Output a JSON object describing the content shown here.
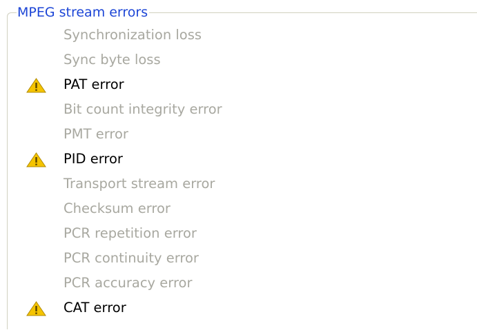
{
  "group": {
    "title": "MPEG stream errors"
  },
  "items": [
    {
      "label": "Synchronization loss",
      "active": false
    },
    {
      "label": "Sync byte loss",
      "active": false
    },
    {
      "label": "PAT error",
      "active": true,
      "icon": "warning-icon"
    },
    {
      "label": "Bit count integrity error",
      "active": false
    },
    {
      "label": "PMT error",
      "active": false
    },
    {
      "label": "PID error",
      "active": true,
      "icon": "warning-icon"
    },
    {
      "label": "Transport stream error",
      "active": false
    },
    {
      "label": "Checksum error",
      "active": false
    },
    {
      "label": "PCR repetition error",
      "active": false
    },
    {
      "label": "PCR continuity error",
      "active": false
    },
    {
      "label": "PCR accuracy error",
      "active": false
    },
    {
      "label": "CAT error",
      "active": true,
      "icon": "warning-icon"
    }
  ],
  "colors": {
    "legend": "#1c45d6",
    "inactive_text": "#a8a8a0",
    "active_text": "#000000",
    "warning_fill": "#f5c400"
  }
}
